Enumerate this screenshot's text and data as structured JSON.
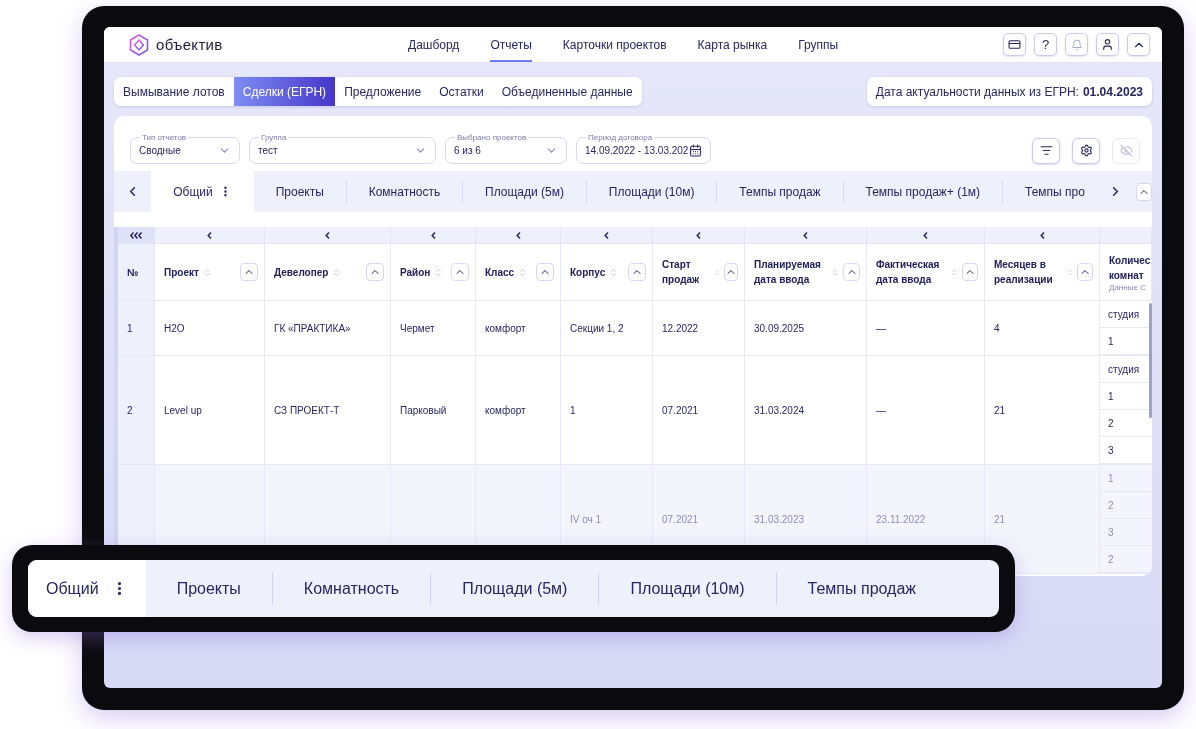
{
  "app": {
    "logo": "объектив",
    "help": "?",
    "nav": [
      {
        "label": "Дашборд",
        "selected": false
      },
      {
        "label": "Отчеты",
        "selected": true
      },
      {
        "label": "Карточки проектов",
        "selected": false
      },
      {
        "label": "Карта рынка",
        "selected": false
      },
      {
        "label": "Группы",
        "selected": false
      }
    ]
  },
  "report_tabs": [
    {
      "label": "Вымывание лотов",
      "selected": false
    },
    {
      "label": "Сделки (ЕГРН)",
      "selected": true
    },
    {
      "label": "Предложение",
      "selected": false
    },
    {
      "label": "Остатки",
      "selected": false
    },
    {
      "label": "Объединенные данные",
      "selected": false
    }
  ],
  "data_date": {
    "label": "Дата актуальности данных из ЕГРН:",
    "value": "01.04.2023"
  },
  "filters": [
    {
      "label": "Тип отчетов",
      "value": "Сводные",
      "kind": "select"
    },
    {
      "label": "Группа",
      "value": "тест",
      "kind": "select"
    },
    {
      "label": "Выбрано проектов",
      "value": "6 из 6",
      "kind": "select"
    },
    {
      "label": "Период договора",
      "value": "14.09.2022 - 13.03.202",
      "kind": "date"
    }
  ],
  "view_tabs": [
    {
      "label": "Общий",
      "selected": true,
      "menu": true
    },
    {
      "label": "Проекты",
      "selected": false,
      "menu": false
    },
    {
      "label": "Комнатность",
      "selected": false,
      "menu": false
    },
    {
      "label": "Площади (5м)",
      "selected": false,
      "menu": false
    },
    {
      "label": "Площади (10м)",
      "selected": false,
      "menu": false
    },
    {
      "label": "Темпы продаж",
      "selected": false,
      "menu": false
    },
    {
      "label": "Темпы продаж+ (1м)",
      "selected": false,
      "menu": false
    },
    {
      "label": "Темпы про",
      "selected": false,
      "menu": false
    }
  ],
  "table": {
    "columns": [
      {
        "label": "№",
        "sortable": false
      },
      {
        "label": "Проект",
        "sortable": true
      },
      {
        "label": "Девелопер",
        "sortable": true
      },
      {
        "label": "Район",
        "sortable": true
      },
      {
        "label": "Класс",
        "sortable": true
      },
      {
        "label": "Корпус",
        "sortable": true
      },
      {
        "label": "Старт продаж",
        "sortable": true
      },
      {
        "label": "Планируемая дата ввода",
        "sortable": true
      },
      {
        "label": "Фактическая дата ввода",
        "sortable": true
      },
      {
        "label": "Месяцев в реализации",
        "sortable": true
      },
      {
        "label": "Количес комнат",
        "subtitle": "Данные С"
      }
    ],
    "rows": [
      {
        "dimmed": false,
        "cells": [
          "1",
          "H2O",
          "ГК «ПРАКТИКА»",
          "Чермет",
          "комфорт",
          "Секции 1, 2",
          "12.2022",
          "30.09.2025",
          "—",
          "4"
        ],
        "rooms": [
          "студия",
          "1"
        ]
      },
      {
        "dimmed": false,
        "cells": [
          "2",
          "Level up",
          "СЗ ПРОЕКТ-Т",
          "Парковый",
          "комфорт",
          "1",
          "07.2021",
          "31.03.2024",
          "—",
          "21"
        ],
        "rooms": [
          "студия",
          "1",
          "2",
          "3"
        ]
      },
      {
        "dimmed": true,
        "cells": [
          null,
          null,
          null,
          null,
          null,
          "IV оч 1",
          "07.2021",
          "31.03.2023",
          "23.11.2022",
          "21"
        ],
        "rooms": [
          "1",
          "2",
          "3",
          "2"
        ]
      }
    ]
  },
  "callout": {
    "tabs": [
      {
        "label": "Общий",
        "selected": true,
        "menu": true
      },
      {
        "label": "Проекты",
        "selected": false,
        "menu": false
      },
      {
        "label": "Комнатность",
        "selected": false,
        "menu": false
      },
      {
        "label": "Площади (5м)",
        "selected": false,
        "menu": false
      },
      {
        "label": "Площади (10м)",
        "selected": false,
        "menu": false
      },
      {
        "label": "Темпы продаж",
        "selected": false,
        "menu": false
      }
    ]
  }
}
